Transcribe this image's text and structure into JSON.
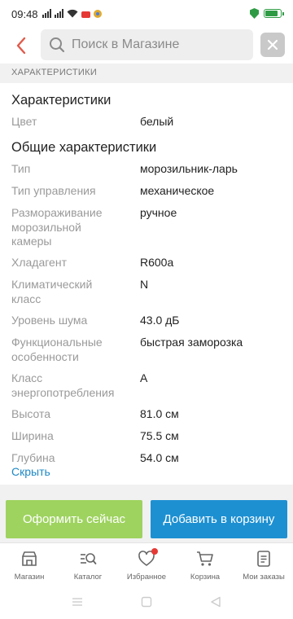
{
  "status_bar": {
    "time": "09:48",
    "battery_level": 0.85
  },
  "search": {
    "placeholder": "Поиск в Магазине"
  },
  "section_header": "ХАРАКТЕРИСТИКИ",
  "characteristics": {
    "title": "Характеристики",
    "color_label": "Цвет",
    "color_value": "белый"
  },
  "general": {
    "title": "Общие характеристики",
    "rows": [
      {
        "label": "Тип",
        "value": "морозильник-ларь"
      },
      {
        "label": "Тип управления",
        "value": "механическое"
      },
      {
        "label": "Размораживание морозильной камеры",
        "value": "ручное"
      },
      {
        "label": "Хладагент",
        "value": "R600a"
      },
      {
        "label": "Климатический класс",
        "value": "N"
      },
      {
        "label": "Уровень шума",
        "value": "43.0 дБ"
      },
      {
        "label": "Функциональные особенности",
        "value": "быстрая заморозка"
      },
      {
        "label": "Класс энергопотребления",
        "value": "A"
      },
      {
        "label": "Высота",
        "value": "81.0 см"
      },
      {
        "label": "Ширина",
        "value": "75.5 см"
      },
      {
        "label": "Глубина",
        "value": "54.0 см"
      }
    ]
  },
  "hide_link": "Скрыть",
  "actions": {
    "order_label": "Оформить сейчас",
    "cart_label": "Добавить в корзину"
  },
  "bottom_nav": [
    {
      "label": "Магазин",
      "icon": "store-icon"
    },
    {
      "label": "Каталог",
      "icon": "catalog-search-icon"
    },
    {
      "label": "Избранное",
      "icon": "heart-icon"
    },
    {
      "label": "Корзина",
      "icon": "cart-icon"
    },
    {
      "label": "Мои заказы",
      "icon": "orders-icon"
    }
  ],
  "colors": {
    "accent_back": "#e05b4b",
    "order_button": "#9ed35f",
    "cart_button": "#1d90d2",
    "link": "#1e88c5",
    "badge": "#e53935"
  }
}
